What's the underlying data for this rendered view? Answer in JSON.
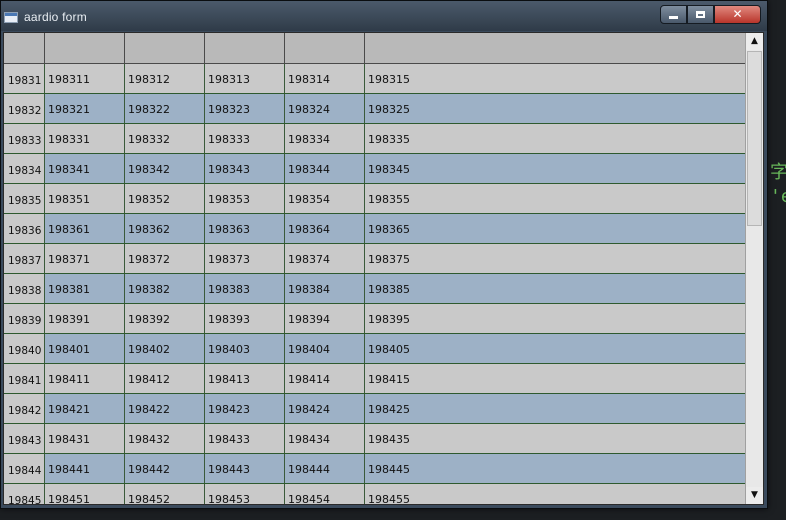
{
  "window": {
    "title": "aardio form",
    "controls": {
      "minimize": "",
      "maximize": "",
      "close": "✕"
    }
  },
  "background_text": {
    "glyph_1": "字",
    "glyph_2": "'e"
  },
  "grid": {
    "column_headers": [
      "",
      "",
      "",
      "",
      "",
      ""
    ],
    "rows": [
      {
        "id": "19831",
        "cells": [
          "198311",
          "198312",
          "198313",
          "198314",
          "198315"
        ]
      },
      {
        "id": "19832",
        "cells": [
          "198321",
          "198322",
          "198323",
          "198324",
          "198325"
        ]
      },
      {
        "id": "19833",
        "cells": [
          "198331",
          "198332",
          "198333",
          "198334",
          "198335"
        ]
      },
      {
        "id": "19834",
        "cells": [
          "198341",
          "198342",
          "198343",
          "198344",
          "198345"
        ]
      },
      {
        "id": "19835",
        "cells": [
          "198351",
          "198352",
          "198353",
          "198354",
          "198355"
        ]
      },
      {
        "id": "19836",
        "cells": [
          "198361",
          "198362",
          "198363",
          "198364",
          "198365"
        ]
      },
      {
        "id": "19837",
        "cells": [
          "198371",
          "198372",
          "198373",
          "198374",
          "198375"
        ]
      },
      {
        "id": "19838",
        "cells": [
          "198381",
          "198382",
          "198383",
          "198384",
          "198385"
        ]
      },
      {
        "id": "19839",
        "cells": [
          "198391",
          "198392",
          "198393",
          "198394",
          "198395"
        ]
      },
      {
        "id": "19840",
        "cells": [
          "198401",
          "198402",
          "198403",
          "198404",
          "198405"
        ]
      },
      {
        "id": "19841",
        "cells": [
          "198411",
          "198412",
          "198413",
          "198414",
          "198415"
        ]
      },
      {
        "id": "19842",
        "cells": [
          "198421",
          "198422",
          "198423",
          "198424",
          "198425"
        ]
      },
      {
        "id": "19843",
        "cells": [
          "198431",
          "198432",
          "198433",
          "198434",
          "198435"
        ]
      },
      {
        "id": "19844",
        "cells": [
          "198441",
          "198442",
          "198443",
          "198444",
          "198445"
        ]
      },
      {
        "id": "19845",
        "cells": [
          "198451",
          "198452",
          "198453",
          "198454",
          "198455"
        ]
      }
    ]
  },
  "scrollbar": {
    "up_icon": "▲",
    "down_icon": "▼"
  },
  "colors": {
    "row_odd": "#c9c9c9",
    "row_even": "#9db1c6",
    "gridline": "#2e5a2e",
    "close_button": "#c7463b"
  }
}
